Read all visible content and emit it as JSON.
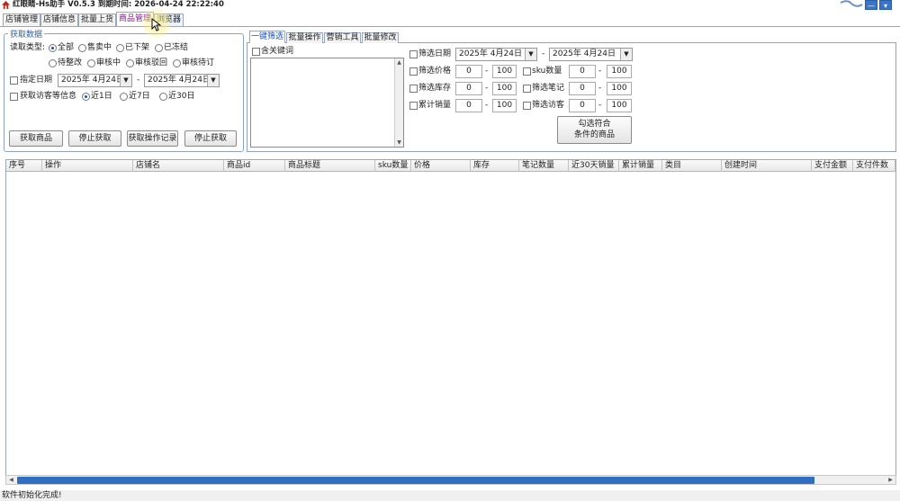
{
  "window": {
    "title": "红眼睛-Hs助手 V0.5.3  到期时间: 2026-04-24 22:22:40",
    "min_label": "—",
    "menu_label": "▾"
  },
  "tabs": [
    {
      "label": "店铺管理"
    },
    {
      "label": "店铺信息"
    },
    {
      "label": "批量上货"
    },
    {
      "label": "商品管理"
    },
    {
      "label": "浏览器"
    }
  ],
  "fetch_panel": {
    "legend": "获取数据",
    "type_label": "读取类型:",
    "types": [
      "全部",
      "售卖中",
      "已下架",
      "已冻结",
      "待整改",
      "审核中",
      "审核驳回",
      "审核待订"
    ],
    "selected_type": "全部",
    "date_check_label": "指定日期",
    "date_from": "2025年  4月24日",
    "date_to": "2025年  4月24日",
    "date_sep": "-",
    "visit_check_label": "获取访客等信息",
    "ranges": [
      "近1日",
      "近7日",
      "近30日"
    ],
    "selected_range": "近1日",
    "buttons": {
      "fetch": "获取商品",
      "stop": "停止获取",
      "fetch_log": "获取操作记录",
      "stop2": "停止获取"
    }
  },
  "filter_panel": {
    "subtabs": [
      {
        "label": "一键筛选"
      },
      {
        "label": "批量操作"
      },
      {
        "label": "营销工具"
      },
      {
        "label": "批量修改"
      }
    ],
    "keyword_label": "含关键词",
    "create_date_label": "筛选日期",
    "create_from": "2025年  4月24日",
    "create_to": "2025年  4月24日",
    "price_label": "筛选价格",
    "price_min": "0",
    "price_max": "100",
    "sku_label": "sku数量",
    "sku_min": "0",
    "sku_max": "100",
    "stock_label": "筛选库存",
    "stock_min": "0",
    "stock_max": "100",
    "notes_label": "筛选笔记",
    "notes_min": "0",
    "notes_max": "100",
    "sales_label": "累计销量",
    "sales_min": "0",
    "sales_max": "100",
    "visitors_label": "筛选访客",
    "visitors_min": "0",
    "visitors_max": "100",
    "dash": "-",
    "select_btn_line1": "勾选符合",
    "select_btn_line2": "条件的商品"
  },
  "grid": {
    "columns": [
      "序号",
      "操作",
      "店铺名",
      "商品id",
      "商品标题",
      "sku数量",
      "价格",
      "库存",
      "笔记数量",
      "近30天销量",
      "累计销量",
      "类目",
      "创建时间",
      "支付金额",
      "支付件数"
    ]
  },
  "status": {
    "text": "软件初始化完成!"
  }
}
